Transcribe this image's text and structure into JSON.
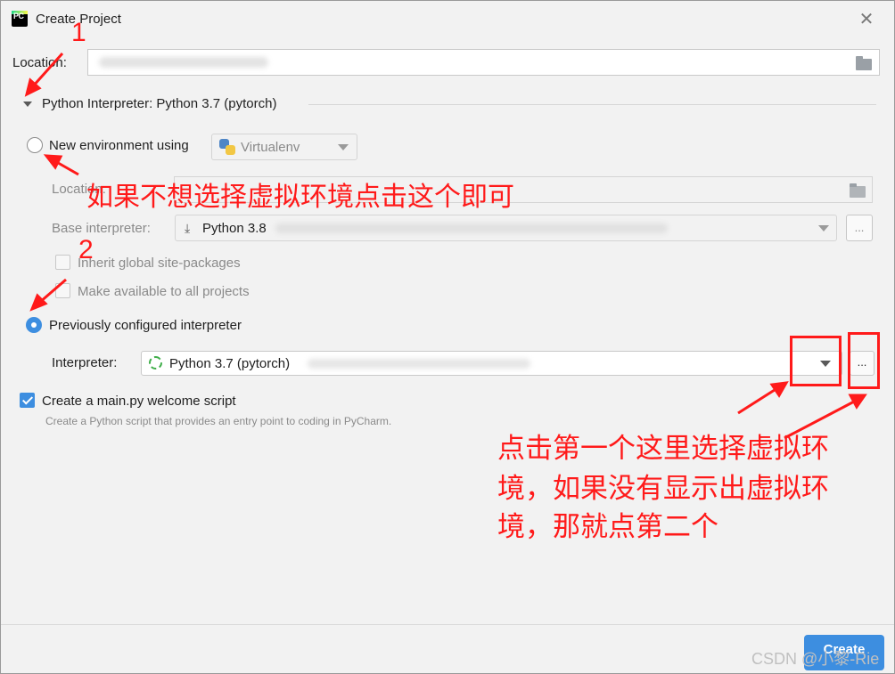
{
  "window": {
    "title": "Create Project",
    "logo_text": "PC"
  },
  "location": {
    "label": "Location:"
  },
  "interpreter_section": {
    "label": "Python Interpreter: Python 3.7 (pytorch)"
  },
  "new_env": {
    "label": "New environment using",
    "tool": "Virtualenv",
    "location_label": "Location:",
    "base_label": "Base interpreter:",
    "base_value": "Python 3.8",
    "inherit_label": "Inherit global site-packages",
    "available_label": "Make available to all projects",
    "browse_label": "..."
  },
  "prev_config": {
    "label": "Previously configured interpreter",
    "interpreter_label": "Interpreter:",
    "interpreter_value": "Python 3.7 (pytorch)",
    "browse_label": "..."
  },
  "welcome": {
    "label": "Create a main.py welcome script",
    "hint": "Create a Python script that provides an entry point to coding in PyCharm."
  },
  "footer": {
    "create_label": "Create",
    "watermark": "CSDN @小黎-Rie"
  },
  "annotations": {
    "num1": "1",
    "num2": "2",
    "note1": "如果不想选择虚拟环境点击这个即可",
    "note2_line1": "点击第一个这里选择虚拟环",
    "note2_line2": "境，如果没有显示出虚拟环",
    "note2_line3": "境，那就点第二个"
  },
  "colors": {
    "accent": "#3d8ee0",
    "annotation": "#ff1a1a"
  },
  "icons": [
    "pycharm-logo-icon",
    "close-icon",
    "folder-icon",
    "triangle-down-icon",
    "python-icon",
    "download-icon",
    "loading-spinner-icon",
    "checkmark-icon"
  ]
}
